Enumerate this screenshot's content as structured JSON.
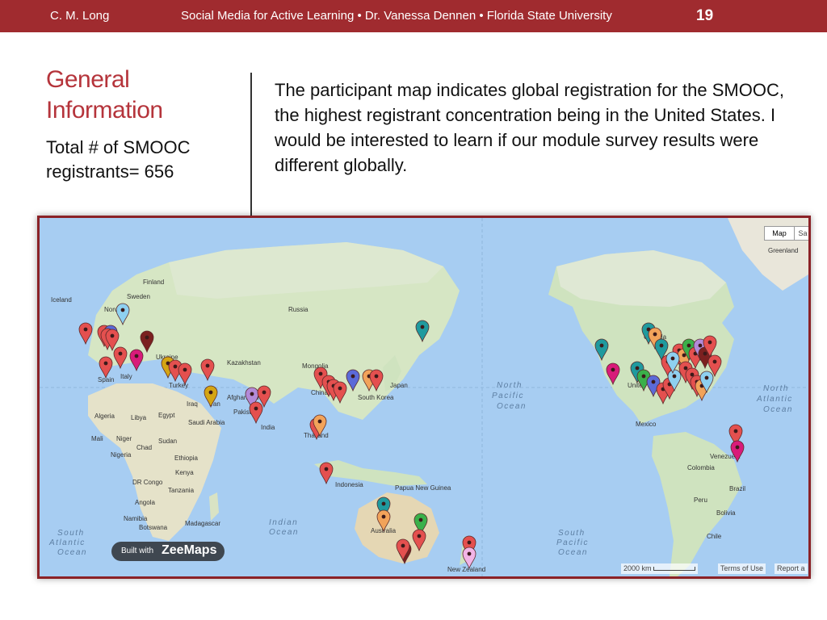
{
  "header": {
    "author": "C. M. Long",
    "course": "Social Media for Active Learning • Dr. Vanessa Dennen • Florida State University",
    "page_number": "19"
  },
  "slide": {
    "title_line1": "General",
    "title_line2": "Information",
    "subtitle_line1": "Total # of SMOOC",
    "subtitle_line2": "registrants= 656",
    "body": "The participant map indicates global registration for the SMOOC, the highest registrant concentration being in the United States. I would be interested to learn if our module survey results were different globally."
  },
  "map": {
    "map_button": "Map",
    "satellite_button": "Sa",
    "built_with": "Built with",
    "brand": "ZeeMaps",
    "scale": "2000 km",
    "terms": "Terms of Use",
    "report": "Report a",
    "oceans": {
      "north_pacific": [
        "North",
        "Pacific",
        "Ocean"
      ],
      "north_atlantic": [
        "North",
        "Atlantic",
        "Ocean"
      ],
      "south_atlantic": [
        "South",
        "Atlantic",
        "Ocean"
      ],
      "indian": [
        "Indian",
        "Ocean"
      ],
      "south_pacific": [
        "South",
        "Pacific",
        "Ocean"
      ]
    },
    "labels": {
      "greenland": "Greenland",
      "iceland": "Iceland",
      "finland": "Finland",
      "sweden": "Sweden",
      "norway": "Norway",
      "russia": "Russia",
      "ukraine": "Ukraine",
      "kazakhstan": "Kazakhstan",
      "mongolia": "Mongolia",
      "spain": "Spain",
      "italy": "Italy",
      "turkey": "Turkey",
      "iraq": "Iraq",
      "iran": "Iran",
      "afghanistan": "Afghanistan",
      "pakistan": "Pakistan",
      "china": "China",
      "japan": "Japan",
      "south_korea": "South Korea",
      "india": "India",
      "thailand": "Thailand",
      "saudi_arabia": "Saudi Arabia",
      "algeria": "Algeria",
      "libya": "Libya",
      "egypt": "Egypt",
      "mali": "Mali",
      "niger": "Niger",
      "chad": "Chad",
      "sudan": "Sudan",
      "nigeria": "Nigeria",
      "ethiopia": "Ethiopia",
      "kenya": "Kenya",
      "dr_congo": "DR Congo",
      "tanzania": "Tanzania",
      "angola": "Angola",
      "namibia": "Namibia",
      "botswana": "Botswana",
      "madagascar": "Madagascar",
      "indonesia": "Indonesia",
      "papua_new_guinea": "Papua New Guinea",
      "australia": "Australia",
      "new_zealand": "New Zealand",
      "canada": "Canada",
      "united_states": "United States",
      "mexico": "Mexico",
      "venezuela": "Venezuela",
      "colombia": "Colombia",
      "peru": "Peru",
      "brazil": "Brazil",
      "bolivia": "Bolivia",
      "chile": "Chile"
    },
    "marker_colors": {
      "red": "#e4504f",
      "teal": "#1f9a9e",
      "pink": "#d81b7a",
      "orange": "#f2a35a",
      "darkred": "#7b2020",
      "blue": "#5b6ad8",
      "gold": "#d4a514",
      "lightblue": "#8ed0f0",
      "green": "#3ab04a",
      "lavender": "#b28ad8",
      "lightpink": "#f2b4e6"
    }
  }
}
